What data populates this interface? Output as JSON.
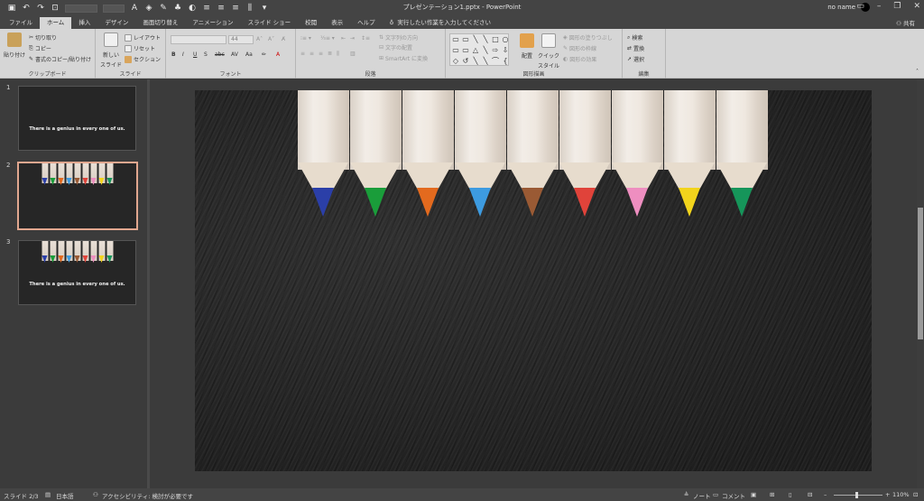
{
  "titlebar": {
    "doc_title": "プレゼンテーション1.pptx - PowerPoint",
    "user_name": "no name",
    "window_controls": [
      "ribbon-display-icon",
      "minimize-icon",
      "restore-icon",
      "close-icon"
    ]
  },
  "tabs": [
    {
      "label": "ファイル",
      "active": false
    },
    {
      "label": "ホーム",
      "active": true
    },
    {
      "label": "挿入",
      "active": false
    },
    {
      "label": "デザイン",
      "active": false
    },
    {
      "label": "画面切り替え",
      "active": false
    },
    {
      "label": "アニメーション",
      "active": false
    },
    {
      "label": "スライド ショー",
      "active": false
    },
    {
      "label": "校閲",
      "active": false
    },
    {
      "label": "表示",
      "active": false
    },
    {
      "label": "ヘルプ",
      "active": false
    }
  ],
  "tellme": "実行したい作業を入力してください",
  "share": "共有",
  "ribbon": {
    "clipboard": {
      "label": "クリップボード",
      "paste": "貼り付け",
      "cut": "切り取り",
      "copy": "コピー",
      "format_painter": "書式のコピー/貼り付け"
    },
    "slides": {
      "label": "スライド",
      "new_slide": "新しい",
      "new_slide_2": "スライド",
      "layout": "レイアウト",
      "reset": "リセット",
      "section": "セクション"
    },
    "font": {
      "label": "フォント",
      "size": "44",
      "buttons": [
        "B",
        "I",
        "U",
        "S",
        "abc",
        "AV",
        "Aa",
        "A"
      ]
    },
    "paragraph": {
      "label": "段落",
      "text_direction": "文字列の方向",
      "align_text": "文字の配置",
      "smartart": "SmartArt に変換"
    },
    "drawing": {
      "label": "図形描画",
      "arrange": "配置",
      "quick_styles": "クイック",
      "quick_styles_2": "スタイル",
      "shape_fill": "図形の塗りつぶし",
      "shape_outline": "図形の枠線",
      "shape_effects": "図形の効果",
      "shapes": [
        "▭",
        "▭",
        "╲",
        "╲",
        "□",
        "○",
        "▭",
        "▭",
        "△",
        "╲",
        "⇨",
        "⇩",
        "◇",
        "↺",
        "╲",
        "╲",
        "⌒",
        "{",
        "}",
        "☆"
      ]
    },
    "editing": {
      "label": "編集",
      "find": "検索",
      "replace": "置換",
      "select": "選択"
    }
  },
  "thumbnails": [
    {
      "number": "1",
      "text": "There is a genius in every one of us.",
      "pencils": false,
      "active": false
    },
    {
      "number": "2",
      "text": "",
      "pencils": true,
      "active": true
    },
    {
      "number": "3",
      "text": "There is a genius in every one of us.",
      "pencils": true,
      "active": false
    }
  ],
  "slide": {
    "pencil_colors": [
      "#2b3fa8",
      "#1a9d3a",
      "#e36a1e",
      "#3d9be0",
      "#9a5a34",
      "#e0433a",
      "#ee8ec0",
      "#f2d41c",
      "#16955a"
    ]
  },
  "statusbar": {
    "slide_info": "スライド 2/3",
    "language": "日本語",
    "accessibility": "アクセシビリティ: 検討が必要です",
    "notes": "ノート",
    "comments": "コメント",
    "zoom": "110%"
  }
}
